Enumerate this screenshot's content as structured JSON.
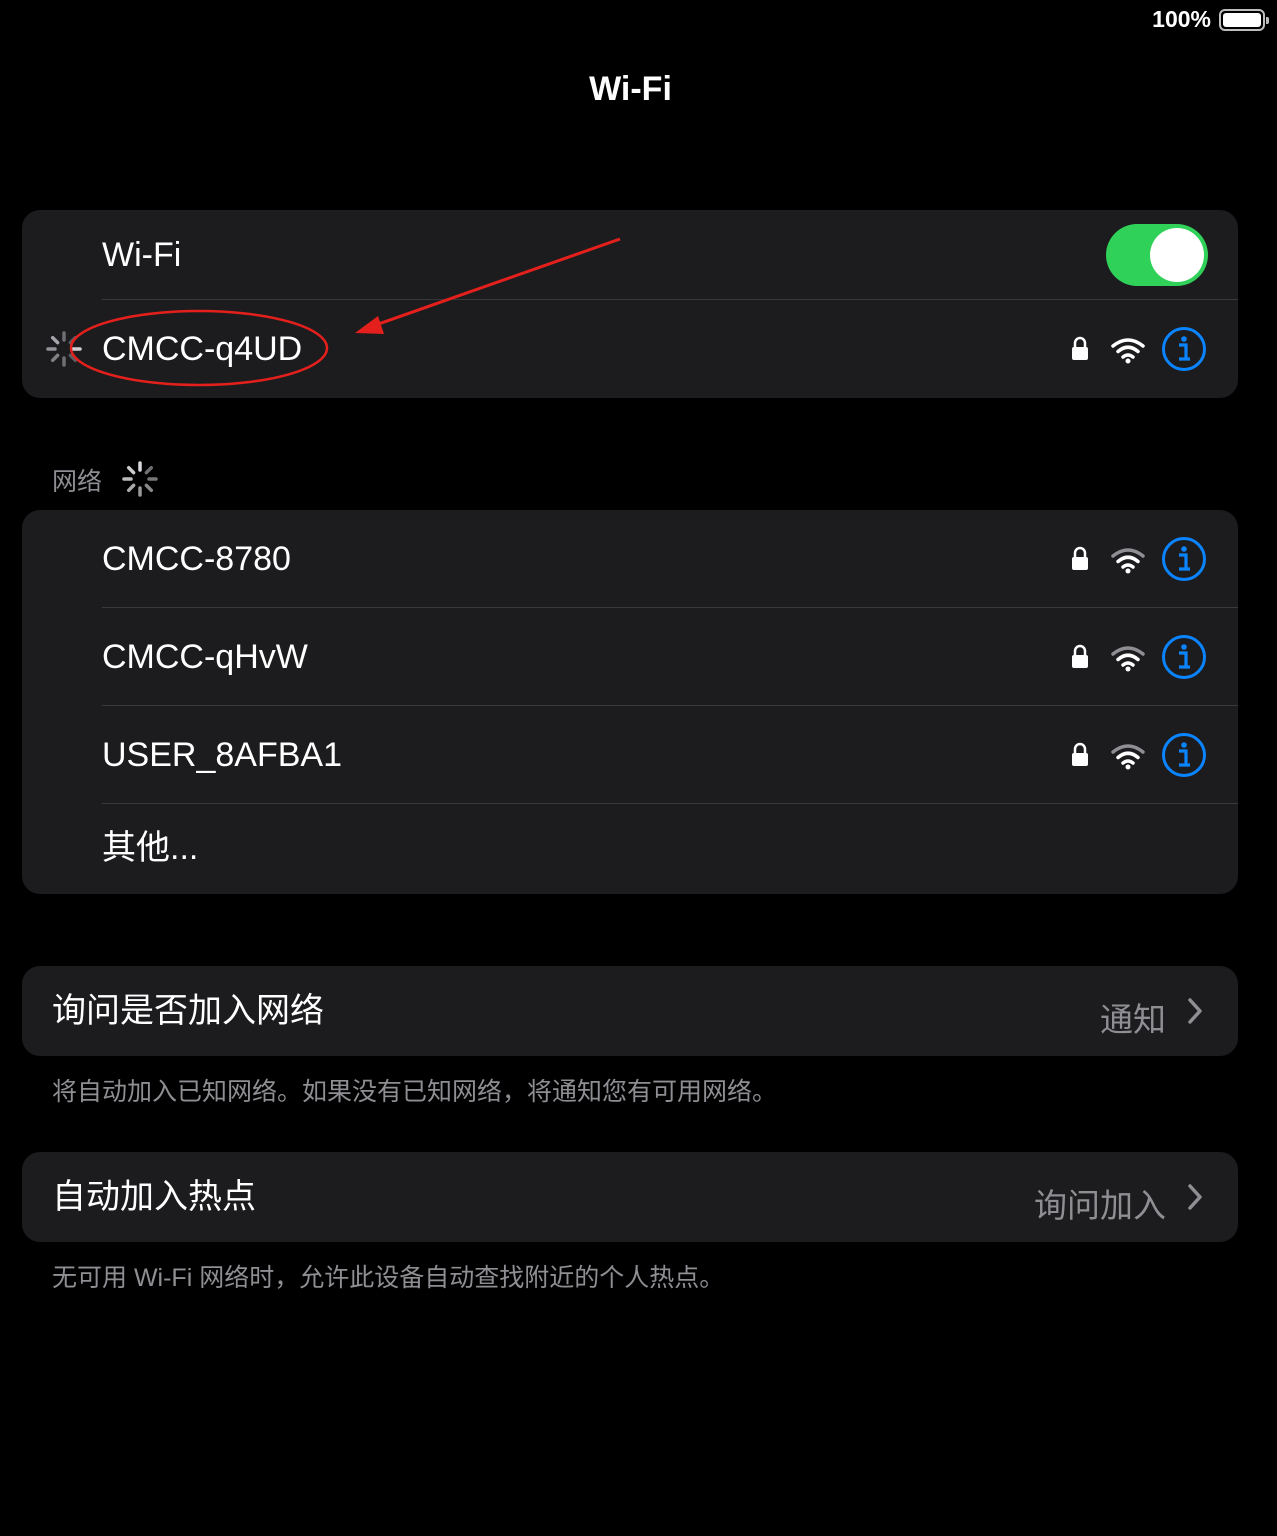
{
  "status_bar": {
    "battery_text": "100%",
    "battery_level": 1.0
  },
  "title": "Wi-Fi",
  "wifi_group": {
    "toggle_label": "Wi-Fi",
    "toggle_on": true,
    "connecting_network": "CMCC-q4UD",
    "toggle_color": "#30d158"
  },
  "networks_section": {
    "header": "网络",
    "items": [
      {
        "name": "CMCC-8780",
        "secured": true
      },
      {
        "name": "CMCC-qHvW",
        "secured": true
      },
      {
        "name": "USER_8AFBA1",
        "secured": true
      }
    ],
    "other": "其他..."
  },
  "ask_to_join": {
    "label": "询问是否加入网络",
    "value": "通知",
    "footnote": "将自动加入已知网络。如果没有已知网络，将通知您有可用网络。"
  },
  "auto_hotspot": {
    "label": "自动加入热点",
    "value": "询问加入",
    "footnote": "无可用 Wi-Fi 网络时，允许此设备自动查找附近的个人热点。"
  },
  "colors": {
    "accent": "#0a84ff",
    "annotation": "#e5201c",
    "background": "#000000",
    "group_bg": "#1c1c1e"
  },
  "icons": [
    "lock-icon",
    "wifi-signal-icon",
    "info-icon",
    "spinner-icon",
    "chevron-right-icon",
    "battery-icon"
  ]
}
